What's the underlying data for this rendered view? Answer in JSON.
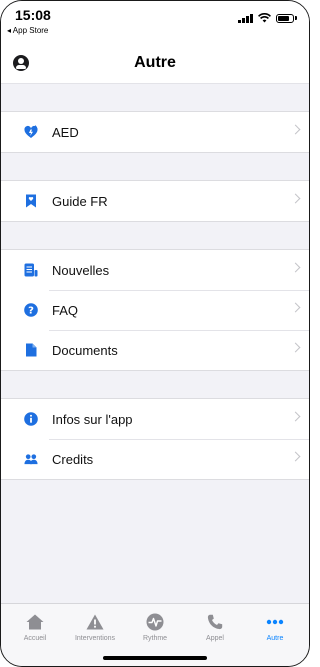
{
  "status_bar": {
    "time": "15:08",
    "back_app": "◂ App Store"
  },
  "navbar": {
    "title": "Autre"
  },
  "groups": [
    {
      "items": [
        {
          "label": "AED",
          "icon": "aed-heart-icon"
        }
      ]
    },
    {
      "items": [
        {
          "label": "Guide FR",
          "icon": "bookmark-icon"
        }
      ]
    },
    {
      "items": [
        {
          "label": "Nouvelles",
          "icon": "news-document-icon"
        },
        {
          "label": "FAQ",
          "icon": "question-circle-icon"
        },
        {
          "label": "Documents",
          "icon": "file-icon"
        }
      ]
    },
    {
      "items": [
        {
          "label": "Infos sur l'app",
          "icon": "info-circle-icon"
        },
        {
          "label": "Credits",
          "icon": "people-icon"
        }
      ]
    }
  ],
  "tab_bar": {
    "tabs": [
      {
        "label": "Accueil",
        "icon": "home-icon",
        "active": false
      },
      {
        "label": "Interventions",
        "icon": "warning-icon",
        "active": false
      },
      {
        "label": "Rythme",
        "icon": "heartbeat-icon",
        "active": false
      },
      {
        "label": "Appel",
        "icon": "phone-icon",
        "active": false
      },
      {
        "label": "Autre",
        "icon": "more-icon",
        "active": true
      }
    ]
  },
  "colors": {
    "accent": "#0a84ff",
    "aed_icon": "#1e6fe0",
    "inactive": "#8e8e93",
    "background": "#f2f2f7"
  }
}
